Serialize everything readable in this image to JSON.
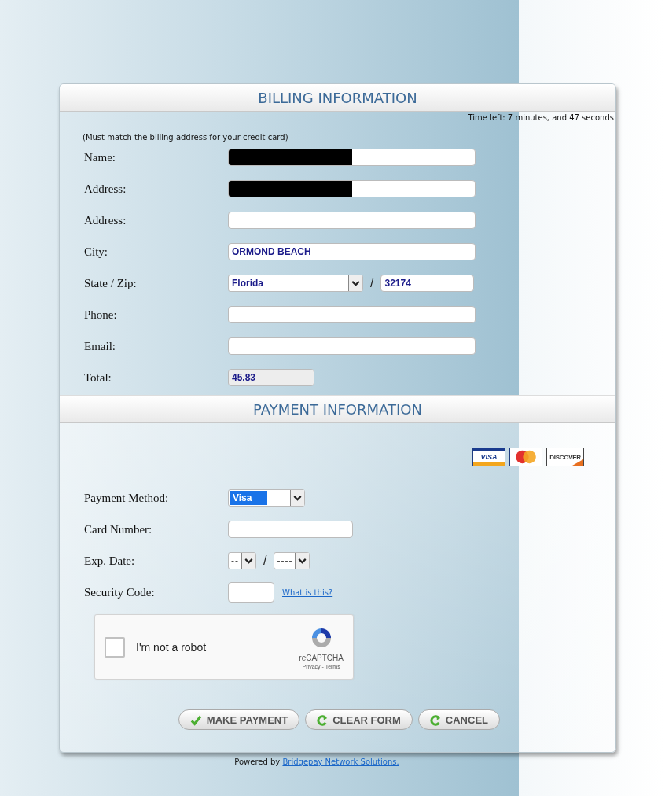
{
  "billing": {
    "title": "BILLING INFORMATION",
    "timer": "Time left: 7 minutes, and 47 seconds",
    "note": "(Must match the billing address for your credit card)",
    "rows": [
      {
        "label": "Name:",
        "kind": "text",
        "redacted": true
      },
      {
        "label": "Address:",
        "kind": "text",
        "redacted": true
      },
      {
        "label": "Address:",
        "kind": "text",
        "redacted": false
      },
      {
        "label": "City:",
        "kind": "text",
        "redacted": false,
        "value": "ORMOND BEACH"
      },
      {
        "label": "State / Zip:",
        "kind": "state_zip",
        "state": "Florida",
        "separator": "/",
        "zip": "32174"
      },
      {
        "label": "Phone:",
        "kind": "text",
        "redacted": false
      },
      {
        "label": "Email:",
        "kind": "text",
        "redacted": false
      },
      {
        "label": "Total:",
        "kind": "readonly",
        "value": "45.83"
      }
    ]
  },
  "payment": {
    "title": "PAYMENT INFORMATION",
    "card_logos": [
      {
        "kind": "visa",
        "label": "VISA"
      },
      {
        "kind": "mastercard"
      },
      {
        "kind": "discover",
        "label": "DISCOVER"
      }
    ],
    "rows": [
      {
        "label": "Payment Method:",
        "kind": "select",
        "value": "Visa",
        "selected": true
      },
      {
        "label": "Card Number:",
        "kind": "short_text"
      },
      {
        "label": "Exp. Date:",
        "kind": "expiry",
        "month": "--",
        "separator": "/",
        "year": "----"
      },
      {
        "label": "Security Code:",
        "kind": "code",
        "link": "What is this?"
      }
    ],
    "captcha": {
      "checked": false,
      "label": "I'm not a robot",
      "brand": "reCAPTCHA",
      "links": "Privacy - Terms"
    },
    "buttons": [
      {
        "label": "MAKE PAYMENT",
        "kind": "submit"
      },
      {
        "label": "CLEAR FORM",
        "kind": "reset"
      },
      {
        "label": "CANCEL",
        "kind": "reset"
      }
    ]
  },
  "footer": {
    "text": "Powered by",
    "link": "Bridgepay Network Solutions."
  }
}
